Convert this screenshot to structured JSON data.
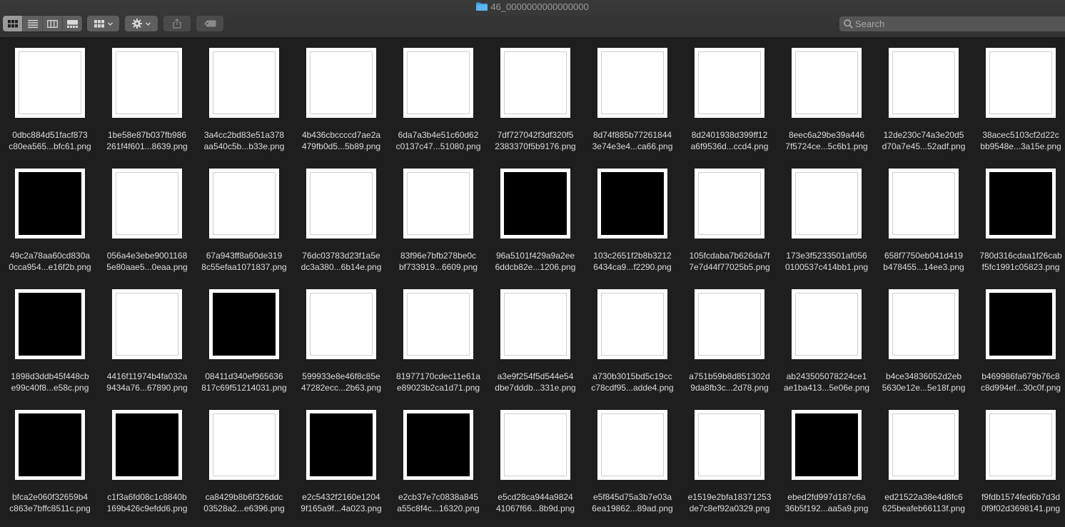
{
  "window": {
    "title": "46_0000000000000000"
  },
  "toolbar": {
    "view_modes": [
      {
        "name": "icon-view-button",
        "icon": "grid-icon",
        "active": true
      },
      {
        "name": "list-view-button",
        "icon": "list-icon",
        "active": false
      },
      {
        "name": "column-view-button",
        "icon": "columns-icon",
        "active": false
      },
      {
        "name": "gallery-view-button",
        "icon": "gallery-icon",
        "active": false
      }
    ],
    "search": {
      "placeholder": "Search",
      "value": ""
    }
  },
  "files": [
    {
      "line1": "0dbc884d51facf873",
      "line2": "c80ea565...bfc61.png",
      "color": "white"
    },
    {
      "line1": "1be58e87b037fb986",
      "line2": "261f4f601...8639.png",
      "color": "white"
    },
    {
      "line1": "3a4cc2bd83e51a378",
      "line2": "aa540c5b...b33e.png",
      "color": "white"
    },
    {
      "line1": "4b436cbccccd7ae2a",
      "line2": "479fb0d5...5b89.png",
      "color": "white"
    },
    {
      "line1": "6da7a3b4e51c60d62",
      "line2": "c0137c47...51080.png",
      "color": "white"
    },
    {
      "line1": "7df727042f3df320f5",
      "line2": "2383370f5b9176.png",
      "color": "white"
    },
    {
      "line1": "8d74f885b77261844",
      "line2": "3e74e3e4...ca66.png",
      "color": "white"
    },
    {
      "line1": "8d2401938d399ff12",
      "line2": "a6f9536d...ccd4.png",
      "color": "white"
    },
    {
      "line1": "8eec6a29be39a446",
      "line2": "7f5724ce...5c6b1.png",
      "color": "white"
    },
    {
      "line1": "12de230c74a3e20d5",
      "line2": "d70a7e45...52adf.png",
      "color": "white"
    },
    {
      "line1": "38acec5103cf2d22c",
      "line2": "bb9548e...3a15e.png",
      "color": "white"
    },
    {
      "line1": "49c2a78aa60cd830a",
      "line2": "0cca954...e16f2b.png",
      "color": "black"
    },
    {
      "line1": "056a4e3ebe9001168",
      "line2": "5e80aae5...0eaa.png",
      "color": "white"
    },
    {
      "line1": "67a943ff8a60de319",
      "line2": "8c55efaa1071837.png",
      "color": "white"
    },
    {
      "line1": "76dc03783d23f1a5e",
      "line2": "dc3a380...6b14e.png",
      "color": "white"
    },
    {
      "line1": "83f96e7bfb278be0c",
      "line2": "bf733919...6609.png",
      "color": "white"
    },
    {
      "line1": "96a5101f429a9a2ee",
      "line2": "6ddcb82e...1206.png",
      "color": "black"
    },
    {
      "line1": "103c2651f2b8b3212",
      "line2": "6434ca9...f2290.png",
      "color": "black"
    },
    {
      "line1": "105fcdaba7b626da7f",
      "line2": "7e7d44f77025b5.png",
      "color": "white"
    },
    {
      "line1": "173e3f5233501af056",
      "line2": "0100537c414bb1.png",
      "color": "white"
    },
    {
      "line1": "658f7750eb041d419",
      "line2": "b478455...14ee3.png",
      "color": "white"
    },
    {
      "line1": "780d316cdaa1f26cab",
      "line2": "f5fc1991c05823.png",
      "color": "black"
    },
    {
      "line1": "1898d3ddb45f448cb",
      "line2": "e99c40f8...e58c.png",
      "color": "black"
    },
    {
      "line1": "4416f11974b4fa032a",
      "line2": "9434a76...67890.png",
      "color": "white"
    },
    {
      "line1": "08411d340ef965636",
      "line2": "817c69f51214031.png",
      "color": "black"
    },
    {
      "line1": "599933e8e46f8c85e",
      "line2": "47282ecc...2b63.png",
      "color": "white"
    },
    {
      "line1": "81977170cdec11e61a",
      "line2": "e89023b2ca1d71.png",
      "color": "white"
    },
    {
      "line1": "a3e9f254f5d544e54",
      "line2": "dbe7dddb...331e.png",
      "color": "white"
    },
    {
      "line1": "a730b3015bd5c19cc",
      "line2": "c78cdf95...adde4.png",
      "color": "white"
    },
    {
      "line1": "a751b59b8d851302d",
      "line2": "9da8fb3c...2d78.png",
      "color": "white"
    },
    {
      "line1": "ab243505078224ce1",
      "line2": "ae1ba413...5e06e.png",
      "color": "white"
    },
    {
      "line1": "b4ce34836052d2eb",
      "line2": "5630e12e...5e18f.png",
      "color": "white"
    },
    {
      "line1": "b469986fa679b76c8",
      "line2": "c8d994ef...30c0f.png",
      "color": "black"
    },
    {
      "line1": "bfca2e060f32659b4",
      "line2": "c863e7bffc8511c.png",
      "color": "black"
    },
    {
      "line1": "c1f3a6fd08c1c8840b",
      "line2": "169b426c9efdd6.png",
      "color": "black"
    },
    {
      "line1": "ca8429b8b6f326ddc",
      "line2": "03528a2...e6396.png",
      "color": "white"
    },
    {
      "line1": "e2c5432f2160e1204",
      "line2": "9f165a9f...4a023.png",
      "color": "black"
    },
    {
      "line1": "e2cb37e7c0838a845",
      "line2": "a55c8f4c...16320.png",
      "color": "black"
    },
    {
      "line1": "e5cd28ca944a9824",
      "line2": "41067f66...8b9d.png",
      "color": "white"
    },
    {
      "line1": "e5f845d75a3b7e03a",
      "line2": "6ea19862...89ad.png",
      "color": "white"
    },
    {
      "line1": "e1519e2bfa18371253",
      "line2": "de7c8ef92a0329.png",
      "color": "white"
    },
    {
      "line1": "ebed2fd997d187c6a",
      "line2": "36b5f192...aa5a9.png",
      "color": "black"
    },
    {
      "line1": "ed21522a38e4d8fc6",
      "line2": "625beafeb66113f.png",
      "color": "white"
    },
    {
      "line1": "f9fdb1574fed6b7d3d",
      "line2": "0f9f02d3698141.png",
      "color": "white"
    }
  ]
}
